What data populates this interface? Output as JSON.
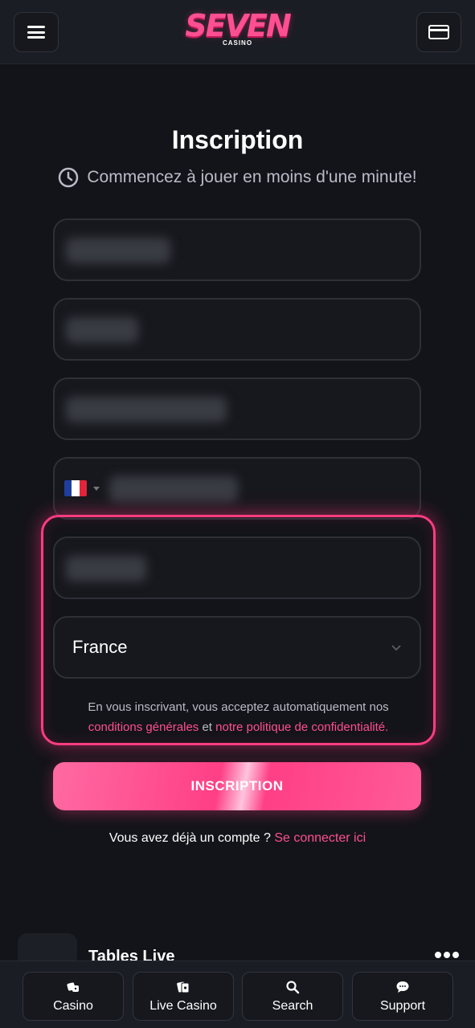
{
  "header": {
    "logo_main": "SEVEN",
    "logo_sub": "CASINO"
  },
  "form": {
    "title": "Inscription",
    "subtitle": "Commencez à jouer en moins d'une minute!",
    "country_value": "France",
    "terms_prefix": "En vous inscrivant, vous acceptez automatiquement nos",
    "terms_link": "conditions générales",
    "terms_mid": "et",
    "privacy_link": "notre politique de confidentialité.",
    "submit_label": "INSCRIPTION",
    "login_prompt": "Vous avez déjà un compte ?",
    "login_link": "Se connecter ici"
  },
  "section": {
    "tables_label": "Tables Live"
  },
  "bottom_nav": [
    {
      "label": "Casino",
      "icon": "dice-icon"
    },
    {
      "label": "Live Casino",
      "icon": "cards-icon"
    },
    {
      "label": "Search",
      "icon": "search-icon"
    },
    {
      "label": "Support",
      "icon": "chat-icon"
    }
  ],
  "colors": {
    "accent": "#ff4f8f",
    "background": "#13141a",
    "highlight": "#ff3d7f"
  }
}
